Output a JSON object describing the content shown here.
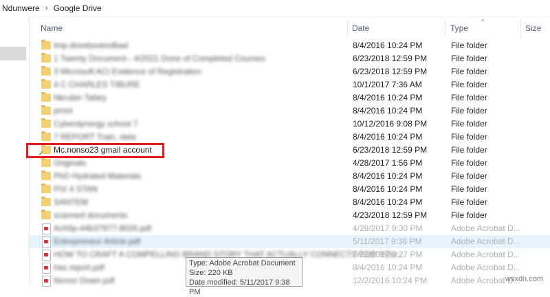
{
  "breadcrumb": {
    "items": [
      "Ndunwere",
      "Google Drive"
    ],
    "sep": "›"
  },
  "columns": {
    "name": "Name",
    "date": "Date",
    "type": "Type",
    "size": "Size",
    "sort_arrow": "^"
  },
  "rows": [
    {
      "name": "tmp.driveboxtoolbad",
      "date": "8/4/2016 10:24 PM",
      "type": "File folder",
      "kind": "folder",
      "blurred": true
    },
    {
      "name": "1 Twenty Document - 4/2021 Done of Completed Courses",
      "date": "6/23/2018 12:59 PM",
      "type": "File folder",
      "kind": "folder",
      "blurred": true
    },
    {
      "name": "3 Microsoft ACI Evidence of Registration",
      "date": "6/23/2018 12:59 PM",
      "type": "File folder",
      "kind": "folder",
      "blurred": true
    },
    {
      "name": "4 C CHARLES TIBURE",
      "date": "10/1/2017 7:36 AM",
      "type": "File folder",
      "kind": "folder",
      "blurred": true
    },
    {
      "name": "Nkrubin Tafary",
      "date": "8/4/2016 10:24 PM",
      "type": "File folder",
      "kind": "folder",
      "blurred": true
    },
    {
      "name": "prnnt",
      "date": "8/4/2016 10:24 PM",
      "type": "File folder",
      "kind": "folder",
      "blurred": true
    },
    {
      "name": "Cyberdynergy school 7",
      "date": "10/12/2016 9:08 PM",
      "type": "File folder",
      "kind": "folder",
      "blurred": true
    },
    {
      "name": "7 REPORT Train, data",
      "date": "8/4/2016 10:24 PM",
      "type": "File folder",
      "kind": "folder",
      "blurred": true
    },
    {
      "name": "Mc.nonso23 gmail account",
      "date": "6/23/2018 12:59 PM",
      "type": "File folder",
      "kind": "folder",
      "blurred": false,
      "sync": true
    },
    {
      "name": "Originals",
      "date": "4/28/2017 1:56 PM",
      "type": "File folder",
      "kind": "folder",
      "blurred": true
    },
    {
      "name": "PhD Hydrated Materials",
      "date": "8/4/2016 10:24 PM",
      "type": "File folder",
      "kind": "folder",
      "blurred": true
    },
    {
      "name": "PIX 4 STAN",
      "date": "8/4/2016 10:24 PM",
      "type": "File folder",
      "kind": "folder",
      "blurred": true
    },
    {
      "name": "SANTEM",
      "date": "8/4/2016 10:24 PM",
      "type": "File folder",
      "kind": "folder",
      "blurred": true
    },
    {
      "name": "scanned documents",
      "date": "4/23/2018 12:59 PM",
      "type": "File folder",
      "kind": "folder",
      "blurred": true
    },
    {
      "name": "Ach0p-44b37977-9026.pdf",
      "date": "4/28/2017 9:30 PM",
      "type": "Adobe Acrobat D...",
      "kind": "pdf",
      "blurred": true,
      "faded": true
    },
    {
      "name": "Entrepreneur Article.pdf",
      "date": "5/11/2017 9:38 PM",
      "type": "Adobe Acrobat D...",
      "kind": "pdf",
      "blurred": true,
      "faded": true,
      "highlight": true
    },
    {
      "name": "HOW TO CRAFT A COMPELLING BRAND STORY THAT ACTUALLY CONNECTS FOR YOU...",
      "date": "7/22/2017 9:27 PM",
      "type": "Adobe Acrobat D...",
      "kind": "pdf",
      "blurred": true,
      "faded": true
    },
    {
      "name": "has report.pdf",
      "date": "8/4/2016 10:24 PM",
      "type": "Adobe Acrobat D...",
      "kind": "pdf",
      "blurred": true,
      "faded": true
    },
    {
      "name": "Nonso Down.pdf",
      "date": "12/2/2016 10:24 PM",
      "type": "Adobe Acrobat D...",
      "kind": "pdf",
      "blurred": true,
      "faded": true
    }
  ],
  "tooltip": {
    "type": "Type: Adobe Acrobat Document",
    "size": "Size: 220 KB",
    "modified": "Date modified: 5/11/2017 9:38 PM"
  },
  "watermark": "wsxdn.com"
}
